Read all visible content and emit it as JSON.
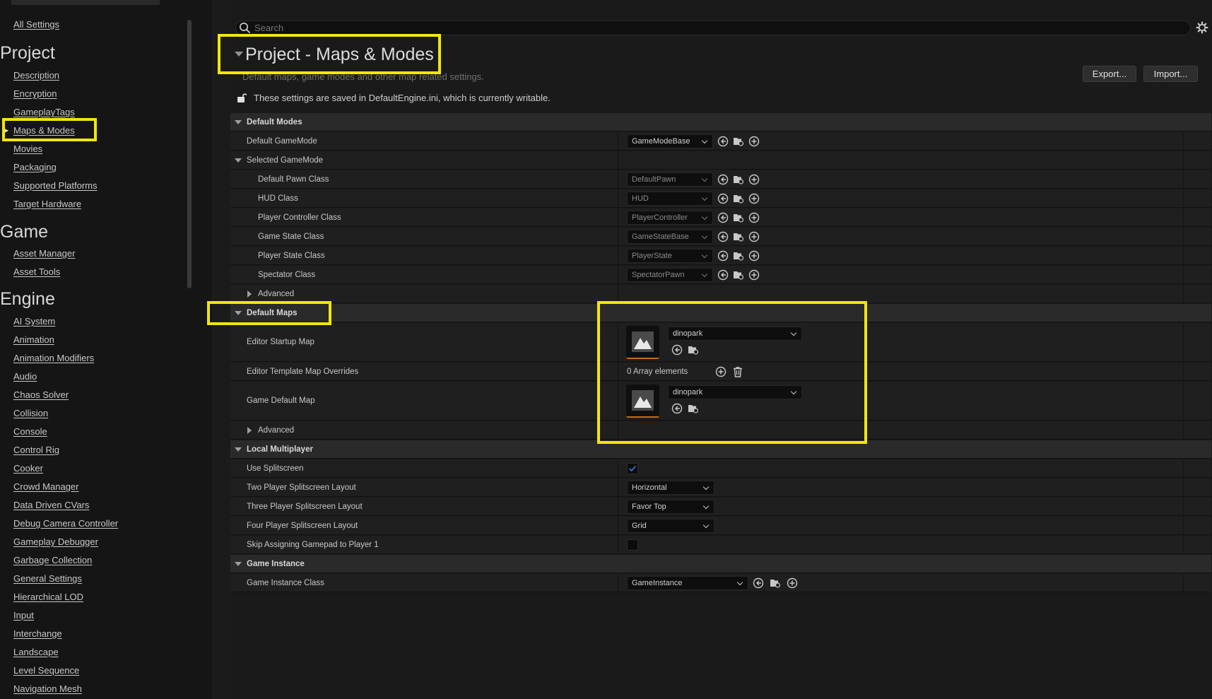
{
  "sidebar": {
    "all_settings": "All Settings",
    "sections": [
      {
        "title": "Project",
        "items": [
          "Description",
          "Encryption",
          "GameplayTags",
          "Maps & Modes",
          "Movies",
          "Packaging",
          "Supported Platforms",
          "Target Hardware"
        ]
      },
      {
        "title": "Game",
        "items": [
          "Asset Manager",
          "Asset Tools"
        ]
      },
      {
        "title": "Engine",
        "items": [
          "AI System",
          "Animation",
          "Animation Modifiers",
          "Audio",
          "Chaos Solver",
          "Collision",
          "Console",
          "Control Rig",
          "Cooker",
          "Crowd Manager",
          "Data Driven CVars",
          "Debug Camera Controller",
          "Gameplay Debugger",
          "Garbage Collection",
          "General Settings",
          "Hierarchical LOD",
          "Input",
          "Interchange",
          "Landscape",
          "Level Sequence",
          "Navigation Mesh"
        ]
      }
    ],
    "active_item": "Maps & Modes"
  },
  "search": {
    "placeholder": "Search"
  },
  "header": {
    "title": "Project - Maps & Modes",
    "description": "Default maps, game modes and other map related settings.",
    "writable_note": "These settings are saved in DefaultEngine.ini, which is currently writable.",
    "export_label": "Export...",
    "import_label": "Import..."
  },
  "default_modes": {
    "category": "Default Modes",
    "default_gamemode_label": "Default GameMode",
    "default_gamemode_value": "GameModeBase",
    "selected_gamemode": "Selected GameMode",
    "default_pawn_label": "Default Pawn Class",
    "default_pawn_value": "DefaultPawn",
    "hud_label": "HUD Class",
    "hud_value": "HUD",
    "player_controller_label": "Player Controller Class",
    "player_controller_value": "PlayerController",
    "game_state_label": "Game State Class",
    "game_state_value": "GameStateBase",
    "player_state_label": "Player State Class",
    "player_state_value": "PlayerState",
    "spectator_label": "Spectator Class",
    "spectator_value": "SpectatorPawn",
    "advanced": "Advanced"
  },
  "default_maps": {
    "category": "Default Maps",
    "editor_startup_label": "Editor Startup Map",
    "editor_startup_value": "dinopark",
    "template_overrides_label": "Editor Template Map Overrides",
    "template_overrides_value": "0 Array elements",
    "game_default_label": "Game Default Map",
    "game_default_value": "dinopark",
    "advanced": "Advanced"
  },
  "local_multiplayer": {
    "category": "Local Multiplayer",
    "use_splitscreen_label": "Use Splitscreen",
    "use_splitscreen_checked": true,
    "two_player_label": "Two Player Splitscreen Layout",
    "two_player_value": "Horizontal",
    "three_player_label": "Three Player Splitscreen Layout",
    "three_player_value": "Favor Top",
    "four_player_label": "Four Player Splitscreen Layout",
    "four_player_value": "Grid",
    "skip_gamepad_label": "Skip Assigning Gamepad to Player 1",
    "skip_gamepad_checked": false
  },
  "game_instance": {
    "category": "Game Instance",
    "class_label": "Game Instance Class",
    "class_value": "GameInstance"
  },
  "colors": {
    "highlight": "#f2e60c",
    "checkbox_accent": "#2a7fe0",
    "thumbnail_accent": "#c56a1a"
  }
}
